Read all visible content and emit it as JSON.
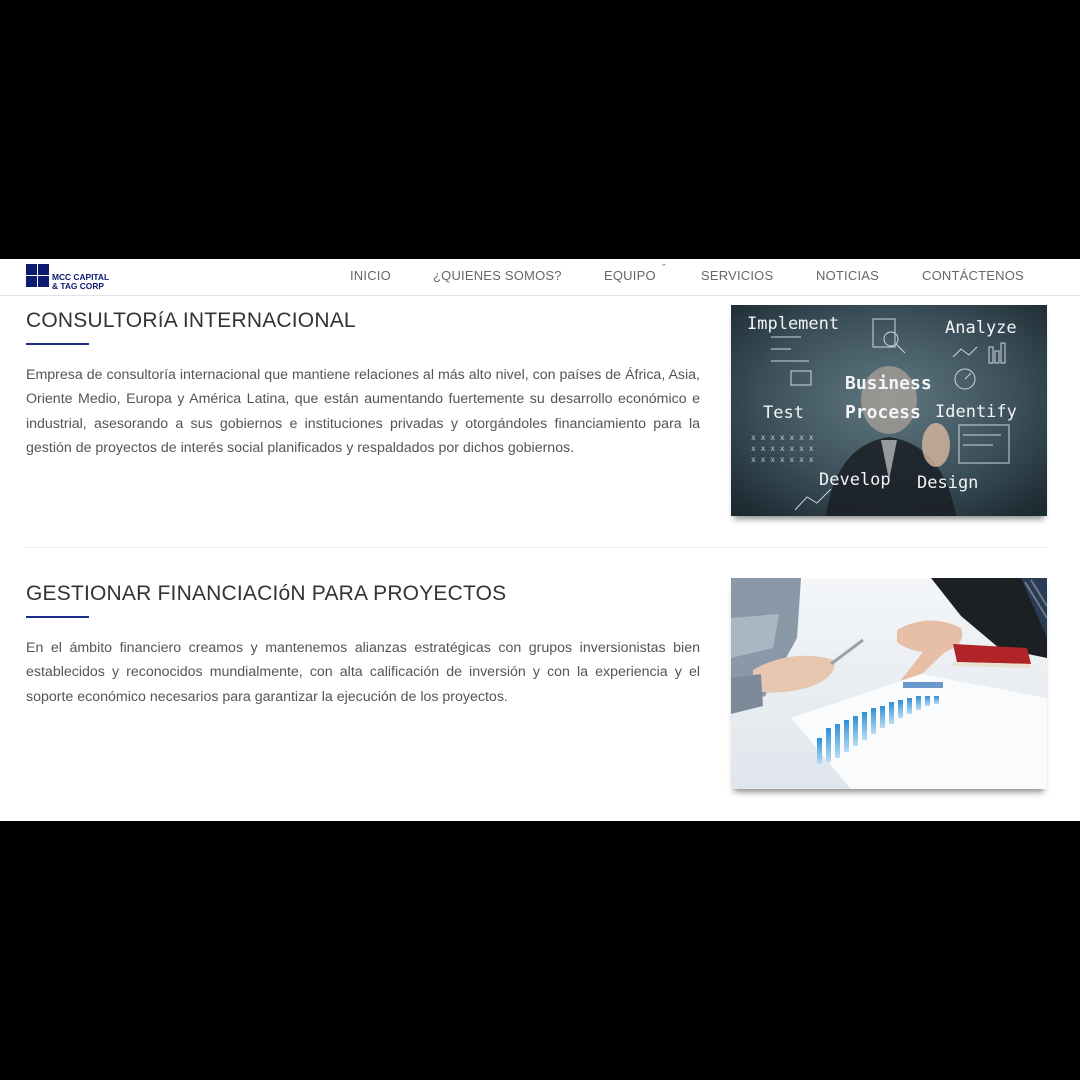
{
  "logo": {
    "line1": "MCC CAPITAL",
    "line2": "& TAG CORP"
  },
  "nav": {
    "items": [
      {
        "label": "INICIO"
      },
      {
        "label": "¿QUIENES SOMOS?"
      },
      {
        "label": "EQUIPO"
      },
      {
        "label": "SERVICIOS"
      },
      {
        "label": "NOTICIAS"
      },
      {
        "label": "CONTÁCTENOS"
      }
    ],
    "dropdown_icon": "chevron-down-icon"
  },
  "sections": [
    {
      "title": "CONSULTORíA INTERNACIONAL",
      "text": "Empresa de consultoría internacional que mantiene relaciones al más alto nivel, con países de África, Asia, Oriente Medio, Europa y América Latina, que están aumentando fuertemente su desarrollo económico e industrial, asesorando a sus gobiernos e instituciones privadas y otorgándoles financiamiento para la gestión de proyectos de interés social planificados y respaldados por dichos gobiernos.",
      "image": {
        "words": {
          "implement": "Implement",
          "analyze": "Analyze",
          "business": "Business",
          "process": "Process",
          "test": "Test",
          "identify": "Identify",
          "develop": "Develop",
          "design": "Design"
        }
      }
    },
    {
      "title": "GESTIONAR FINANCIACIóN PARA PROYECTOS",
      "text": "En el ámbito financiero creamos y mantenemos alianzas estratégicas con grupos inversionistas bien establecidos y reconocidos mundialmente, con alta calificación de inversión y con la experiencia y el soporte económico necesarios para garantizar la ejecución de los proyectos."
    }
  ],
  "colors": {
    "accent": "#1b2a8c",
    "logo": "#0d1a6e",
    "nav_text": "#666666",
    "body_text": "#555555",
    "frame": "#000000"
  }
}
